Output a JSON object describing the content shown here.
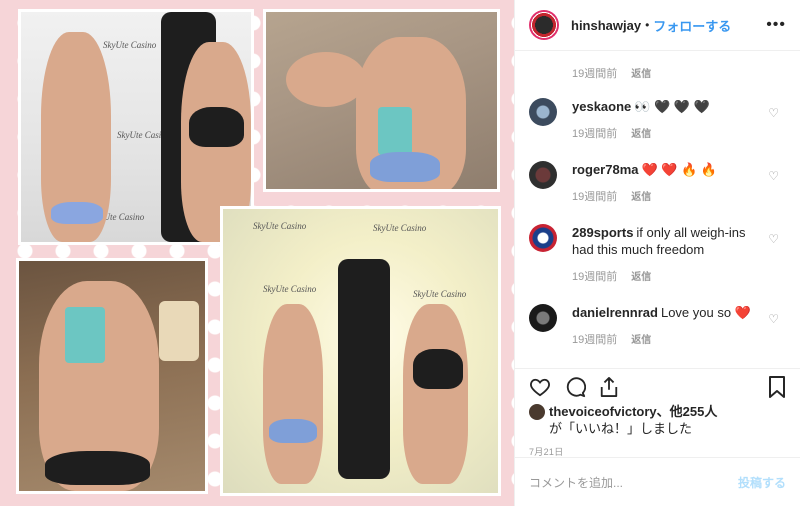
{
  "post": {
    "username": "hinshawjay",
    "separator": "•",
    "follow_label": "フォローする",
    "more_label": "•••"
  },
  "image": {
    "logo_text": "SkyUte Casino"
  },
  "first_meta": {
    "time": "19週間前",
    "reply": "返信"
  },
  "comments": [
    {
      "username": "yeskaone",
      "text": "👀 🖤 🖤 🖤",
      "time": "19週間前",
      "reply": "返信"
    },
    {
      "username": "roger78ma",
      "text": "❤️ ❤️ 🔥 🔥",
      "time": "19週間前",
      "reply": "返信"
    },
    {
      "username": "289sports",
      "text": "if only all weigh-ins had this much freedom",
      "time": "19週間前",
      "reply": "返信"
    },
    {
      "username": "danielrennrad",
      "text": "Love you so ❤️",
      "time": "19週間前",
      "reply": "返信"
    }
  ],
  "likes": {
    "liker": "thevoiceofvictory",
    "others": "、他255人",
    "suffix": "が「いいね！」しました"
  },
  "date": "7月21日",
  "comment_input": {
    "placeholder": "コメントを追加...",
    "post_label": "投稿する"
  },
  "colors": {
    "accent": "#3897f0",
    "background_pink": "#f6d5d8"
  },
  "icons": [
    "heart-icon",
    "comment-icon",
    "share-icon",
    "bookmark-icon",
    "more-icon"
  ]
}
